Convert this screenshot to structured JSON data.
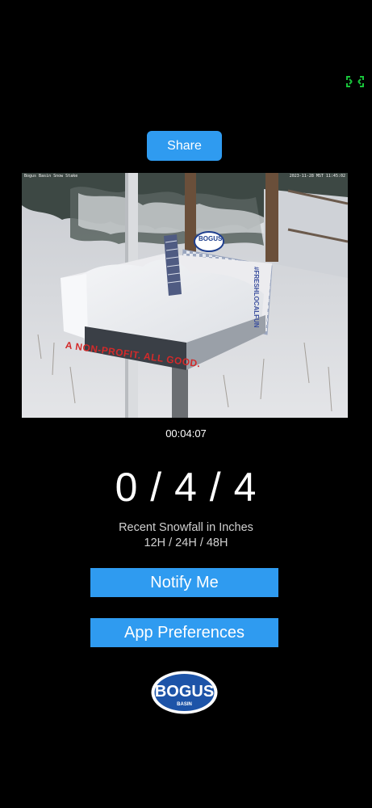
{
  "icons": {
    "fullscreen": "fullscreen-icon"
  },
  "colors": {
    "background": "#000000",
    "button": "#2f9bf0",
    "fullscreen_icon": "#18c43a",
    "logo_blue": "#1d54a8"
  },
  "share": {
    "label": "Share"
  },
  "webcam": {
    "overlay_left": "Bogus Basin Snow Stake",
    "overlay_right": "2023-11-28 MST 11:45:02",
    "sign_text": "A NON-PROFIT. ALL GOOD.",
    "side_text": "#FRESHLOCALFUN",
    "stake_logo": "BOGUS"
  },
  "video": {
    "timestamp": "00:04:07"
  },
  "snowfall": {
    "values": "0 / 4 / 4",
    "caption": "Recent Snowfall in Inches",
    "periods": "12H / 24H / 48H"
  },
  "buttons": {
    "notify_label": "Notify Me",
    "preferences_label": "App Preferences"
  },
  "logo": {
    "name": "BOGUS",
    "sub": "BASIN"
  }
}
